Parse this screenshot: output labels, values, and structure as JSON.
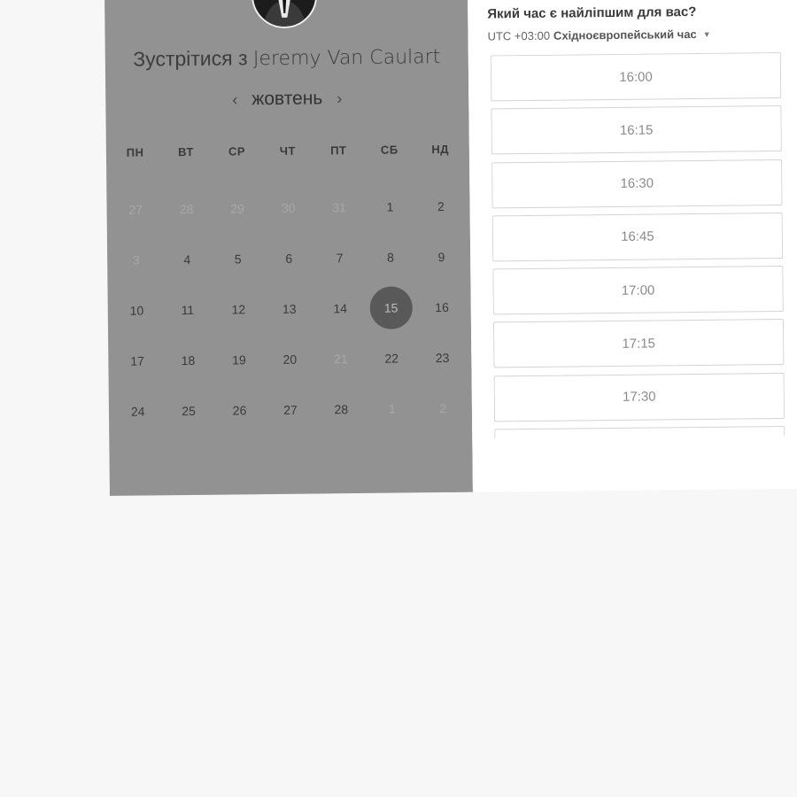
{
  "calendar": {
    "title_prefix": "Зустрітися з",
    "host_name": "Jeremy Van Caulart",
    "month_label": "жовтень",
    "prev_arrow": "‹",
    "next_arrow": "›",
    "weekdays": [
      "ПН",
      "ВТ",
      "СР",
      "ЧТ",
      "ПТ",
      "СБ",
      "НД"
    ],
    "weeks": [
      [
        {
          "d": "27",
          "muted": true
        },
        {
          "d": "28",
          "muted": true
        },
        {
          "d": "29",
          "muted": true
        },
        {
          "d": "30",
          "muted": true
        },
        {
          "d": "31",
          "muted": true
        },
        {
          "d": "1",
          "muted": false
        },
        {
          "d": "2",
          "muted": false
        }
      ],
      [
        {
          "d": "3",
          "muted": true
        },
        {
          "d": "4",
          "muted": false
        },
        {
          "d": "5",
          "muted": false
        },
        {
          "d": "6",
          "muted": false
        },
        {
          "d": "7",
          "muted": false
        },
        {
          "d": "8",
          "muted": false
        },
        {
          "d": "9",
          "muted": false
        }
      ],
      [
        {
          "d": "10",
          "muted": false
        },
        {
          "d": "11",
          "muted": false
        },
        {
          "d": "12",
          "muted": false
        },
        {
          "d": "13",
          "muted": false
        },
        {
          "d": "14",
          "muted": false
        },
        {
          "d": "15",
          "muted": false,
          "selected": true
        },
        {
          "d": "16",
          "muted": false
        }
      ],
      [
        {
          "d": "17",
          "muted": false
        },
        {
          "d": "18",
          "muted": false
        },
        {
          "d": "19",
          "muted": false
        },
        {
          "d": "20",
          "muted": false
        },
        {
          "d": "21",
          "muted": true
        },
        {
          "d": "22",
          "muted": false
        },
        {
          "d": "23",
          "muted": false
        }
      ],
      [
        {
          "d": "24",
          "muted": false
        },
        {
          "d": "25",
          "muted": false
        },
        {
          "d": "26",
          "muted": false
        },
        {
          "d": "27",
          "muted": false
        },
        {
          "d": "28",
          "muted": false
        },
        {
          "d": "1",
          "muted": true
        },
        {
          "d": "2",
          "muted": true
        }
      ]
    ]
  },
  "times": {
    "question": "Який час є найліпшим для вас?",
    "tz_offset": "UTC +03:00",
    "tz_name": "Східноєвропейський час",
    "slots": [
      "16:00",
      "16:15",
      "16:30",
      "16:45",
      "17:00",
      "17:15",
      "17:30",
      ""
    ]
  },
  "colors": {
    "calendar_bg": "#929292",
    "selected_day": "#595959",
    "page_bg": "#f7f7f7"
  },
  "icons": {
    "avatar": "host-photo",
    "timezone_caret": "caret-down-icon"
  }
}
